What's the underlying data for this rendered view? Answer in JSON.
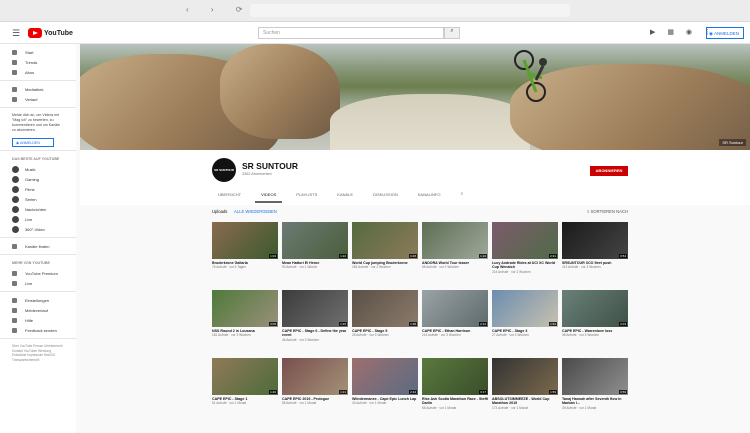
{
  "browser": {
    "nav_icons": "‹ › ⟳"
  },
  "header": {
    "logo_text": "YouTube",
    "search_placeholder": "Suchen",
    "search_icon": "search-icon",
    "icons": "▶ ▦ ◉ ⋮",
    "sign_in": "ANMELDEN"
  },
  "sidebar": {
    "items": [
      {
        "label": "Start"
      },
      {
        "label": "Trends"
      },
      {
        "label": "Abos"
      }
    ],
    "library": [
      {
        "label": "Mediathek"
      },
      {
        "label": "Verlauf"
      }
    ],
    "promo": "Melde dich an, um Videos mit \"Mag ich\" zu bewerten, zu kommentieren und um Kanäle zu abonnieren.",
    "sign_in": "ANMELDEN",
    "best_heading": "DAS BESTE AUF YOUTUBE",
    "best": [
      {
        "label": "Musik"
      },
      {
        "label": "Gaming"
      },
      {
        "label": "Filme"
      },
      {
        "label": "Serien"
      },
      {
        "label": "Nachrichten"
      },
      {
        "label": "Live"
      },
      {
        "label": "360°-Video"
      }
    ],
    "browse_channels": "Kanäle finden",
    "more_heading": "MEHR VON YOUTUBE",
    "more": [
      {
        "label": "YouTube Premium"
      },
      {
        "label": "Live"
      }
    ],
    "settings": [
      {
        "label": "Einstellungen"
      },
      {
        "label": "Meldeverlauf"
      },
      {
        "label": "Hilfe"
      },
      {
        "label": "Feedback senden"
      }
    ],
    "footer": "Über YouTube Presse Urheberrecht Kontakt YouTuber Werbung Entwickler Impressum NetzDG Transparenzbericht"
  },
  "channel": {
    "avatar_text": "SR SUNTOUR",
    "name": "SR SUNTOUR",
    "subscribers": "3362 Abonnenten",
    "subscribe": "ABONNIEREN",
    "tabs": [
      "Übersicht",
      "Videos",
      "Playlists",
      "Kanäle",
      "Diskussion",
      "Kanalinfo"
    ],
    "active_tab": "Videos",
    "uploads_label": "Uploads",
    "play_all": "ALLE WIEDERGEBEN",
    "sort": "SORTIEREN NACH"
  },
  "videos": [
    {
      "title": "Bruderkrone Gallaria",
      "meta": "76 Aufrufe · vor 6 Tagen",
      "duration": "1:04",
      "c1": "#8a6a4f",
      "c2": "#3b5a2e"
    },
    {
      "title": "Mean Hattori El Heroe",
      "meta": "90 Aufrufe · vor 1 Woche",
      "duration": "1:22",
      "c1": "#6c7a73",
      "c2": "#4a5f3d"
    },
    {
      "title": "World Cup jumping Bruderkrone",
      "meta": "283 Aufrufe · vor 2 Wochen",
      "duration": "0:48",
      "c1": "#556b3f",
      "c2": "#8c7a5b"
    },
    {
      "title": "ANDORA World Tour teaser",
      "meta": "58 Aufrufe · vor 2 Wochen",
      "duration": "1:10",
      "c1": "#5d6f54",
      "c2": "#a0a89a"
    },
    {
      "title": "Lucy Andrade Rides at UCI XC World Cup Wenatch",
      "meta": "214 Aufrufe · vor 2 Wochen",
      "duration": "2:31",
      "c1": "#7d5a6b",
      "c2": "#4f6c48"
    },
    {
      "title": "SRSUNTOUR XCO fleet push",
      "meta": "413 Aufrufe · vor 3 Wochen",
      "duration": "0:54",
      "c1": "#1b1b1b",
      "c2": "#444444"
    },
    {
      "title": "NSS Round 2 in Lousana",
      "meta": "181 Aufrufe · vor 3 Wochen",
      "duration": "3:05",
      "c1": "#4f7a3a",
      "c2": "#99907a"
    },
    {
      "title": "CAPE EPIC - Stage 6 - Define the year event",
      "meta": "46 Aufrufe · vor 3 Wochen",
      "duration": "1:45",
      "c1": "#3c3c3c",
      "c2": "#6f6f6f"
    },
    {
      "title": "CAPE EPIC - Stage 5",
      "meta": "28 Aufrufe · vor 3 Wochen",
      "duration": "1:38",
      "c1": "#5a5046",
      "c2": "#8b7b6b"
    },
    {
      "title": "CAPE EPIC - Ethan Harrison",
      "meta": "114 Aufrufe · vor 3 Wochen",
      "duration": "2:12",
      "c1": "#9aa3a6",
      "c2": "#5e6a6c"
    },
    {
      "title": "CAPE EPIC - Stage 3",
      "meta": "27 Aufrufe · vor 3 Wochen",
      "duration": "1:52",
      "c1": "#6b8db0",
      "c2": "#c8c1ae"
    },
    {
      "title": "CAPE EPIC - Warrenlove loss",
      "meta": "38 Aufrufe · vor 3 Wochen",
      "duration": "2:03",
      "c1": "#6a8078",
      "c2": "#3e5147"
    },
    {
      "title": "CAPE EPIC - Stage 1",
      "meta": "51 Aufrufe · vor 1 Monat",
      "duration": "1:40",
      "c1": "#8f7a58",
      "c2": "#4e6b3b"
    },
    {
      "title": "CAPE EPIC 2019 - Prologue",
      "meta": "58 Aufrufe · vor 1 Monat",
      "duration": "1:21",
      "c1": "#7a4e4e",
      "c2": "#a39277"
    },
    {
      "title": "Wlindermanee - Cape Epic Lunch Lap",
      "meta": "43 Aufrufe · vor 1 Monat",
      "duration": "2:44",
      "c1": "#9c6e6e",
      "c2": "#5c6c83"
    },
    {
      "title": "Rise Ash Scotia Marathon Race - Steffi Darlin",
      "meta": "66 Aufrufe · vor 1 Monat",
      "duration": "3:17",
      "c1": "#5a7a3e",
      "c2": "#3a4d2b"
    },
    {
      "title": "ABSOLUTSIMMEEZE - World Cup Marathon 2019",
      "meta": "173 Aufrufe · vor 1 Monat",
      "duration": "1:59",
      "c1": "#333333",
      "c2": "#7b6a4d"
    },
    {
      "title": "Tanaj Hannah after Seventh flow in Marban I...",
      "meta": "39 Aufrufe · vor 1 Monat",
      "duration": "0:59",
      "c1": "#4a4a4a",
      "c2": "#8f8f8f"
    }
  ],
  "banner": {
    "links": "SR Suntour"
  }
}
